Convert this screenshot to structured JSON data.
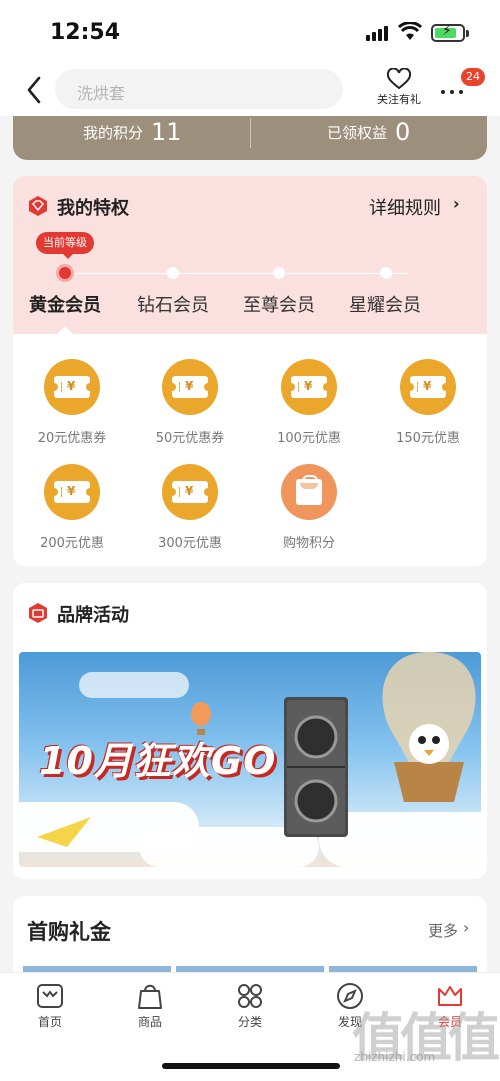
{
  "status_bar": {
    "time": "12:54"
  },
  "nav": {
    "search_placeholder": "洗烘套",
    "follow_label": "关注有礼",
    "badge_count": "24"
  },
  "points_bar": {
    "my_points_label": "我的积分",
    "my_points_value": "11",
    "claimed_label": "已领权益",
    "claimed_value": "0"
  },
  "privileges": {
    "title": "我的特权",
    "rules_link": "详细规则",
    "current_tag": "当前等级",
    "levels": [
      "黄金会员",
      "钻石会员",
      "至尊会员",
      "星耀会员"
    ],
    "current_level_index": 0,
    "benefits": [
      {
        "label": "20元优惠券",
        "icon": "coupon-icon"
      },
      {
        "label": "50元优惠券",
        "icon": "coupon-icon"
      },
      {
        "label": "100元优惠",
        "icon": "coupon-icon"
      },
      {
        "label": "150元优惠",
        "icon": "coupon-icon"
      },
      {
        "label": "200元优惠",
        "icon": "coupon-icon"
      },
      {
        "label": "300元优惠",
        "icon": "coupon-icon"
      },
      {
        "label": "购物积分",
        "icon": "shopping-bag-icon"
      }
    ]
  },
  "brand": {
    "title": "品牌活动",
    "banner_text": "10月狂欢GO"
  },
  "first_purchase": {
    "title": "首购礼金",
    "more_label": "更多"
  },
  "tabbar": {
    "tabs": [
      {
        "label": "首页",
        "icon": "home-icon"
      },
      {
        "label": "商品",
        "icon": "shopping-bag-icon"
      },
      {
        "label": "分类",
        "icon": "category-icon"
      },
      {
        "label": "发现",
        "icon": "discover-icon"
      },
      {
        "label": "会员",
        "icon": "member-crown-icon"
      }
    ],
    "active_index": 4
  },
  "watermark": {
    "text": "值值值",
    "url": "zhizhizhi.com"
  },
  "colors": {
    "accent": "#e23a32",
    "gold": "#eaa72c",
    "points_bar": "#9c8f7b",
    "privilege_bg": "#fbe0e0"
  }
}
